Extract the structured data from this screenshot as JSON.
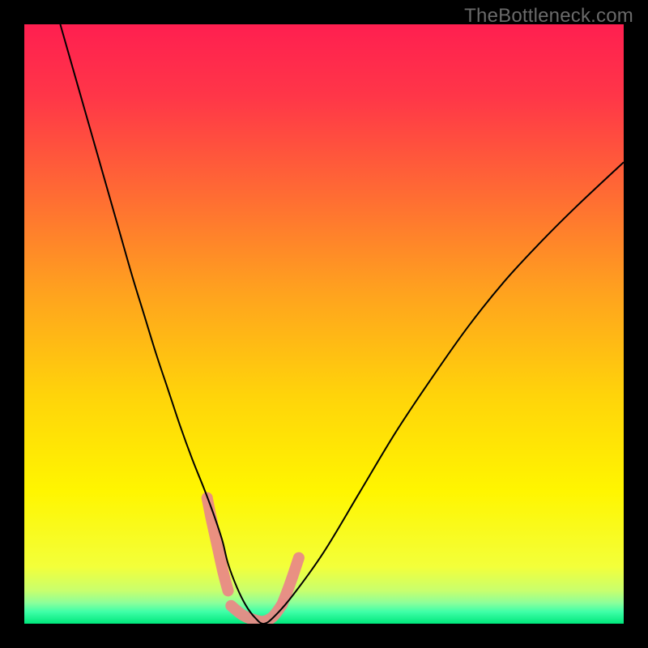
{
  "watermark": "TheBottleneck.com",
  "chart_data": {
    "type": "line",
    "title": "",
    "xlabel": "",
    "ylabel": "",
    "xlim": [
      0,
      100
    ],
    "ylim": [
      0,
      100
    ],
    "grid": false,
    "background_gradient": {
      "stops": [
        {
          "offset": 0.0,
          "color": "#ff1f50"
        },
        {
          "offset": 0.12,
          "color": "#ff3648"
        },
        {
          "offset": 0.28,
          "color": "#ff6a34"
        },
        {
          "offset": 0.45,
          "color": "#ffa31e"
        },
        {
          "offset": 0.62,
          "color": "#ffd40a"
        },
        {
          "offset": 0.78,
          "color": "#fff600"
        },
        {
          "offset": 0.905,
          "color": "#f3ff3a"
        },
        {
          "offset": 0.945,
          "color": "#c8ff6e"
        },
        {
          "offset": 0.965,
          "color": "#8dff9a"
        },
        {
          "offset": 0.98,
          "color": "#3fffa8"
        },
        {
          "offset": 1.0,
          "color": "#00e77b"
        }
      ]
    },
    "series": [
      {
        "name": "bottleneck-curve",
        "color": "#000000",
        "width": 2,
        "x": [
          6,
          8,
          10,
          12,
          14,
          16,
          18,
          20,
          22,
          24,
          26,
          28,
          30,
          31.5,
          33,
          34,
          35.5,
          37,
          38.5,
          40,
          42,
          45,
          50,
          56,
          62,
          68,
          74,
          80,
          86,
          92,
          100
        ],
        "y": [
          100,
          93,
          86,
          79,
          72,
          65,
          58,
          51.5,
          45,
          39,
          33,
          27.5,
          22.5,
          18.5,
          14,
          10,
          6,
          3,
          1,
          0,
          1.5,
          5,
          12,
          22,
          32,
          41,
          49.5,
          57,
          63.5,
          69.5,
          77
        ]
      }
    ],
    "highlight": {
      "name": "near-zero-highlight",
      "color": "#e98a86",
      "opacity": 0.95,
      "width": 14,
      "segments": [
        {
          "x": [
            30.5,
            31.2,
            32.2,
            33.2,
            34.0
          ],
          "y": [
            21,
            17.5,
            13,
            8.5,
            5.5
          ]
        },
        {
          "x": [
            34.5,
            36.5,
            38.5,
            40.0,
            41.5,
            43.0
          ],
          "y": [
            3.0,
            1.4,
            0.6,
            0.4,
            1.2,
            3.2
          ]
        },
        {
          "x": [
            43.0,
            43.8,
            44.8,
            45.8
          ],
          "y": [
            3.2,
            5.2,
            8.0,
            11.0
          ]
        }
      ]
    }
  }
}
